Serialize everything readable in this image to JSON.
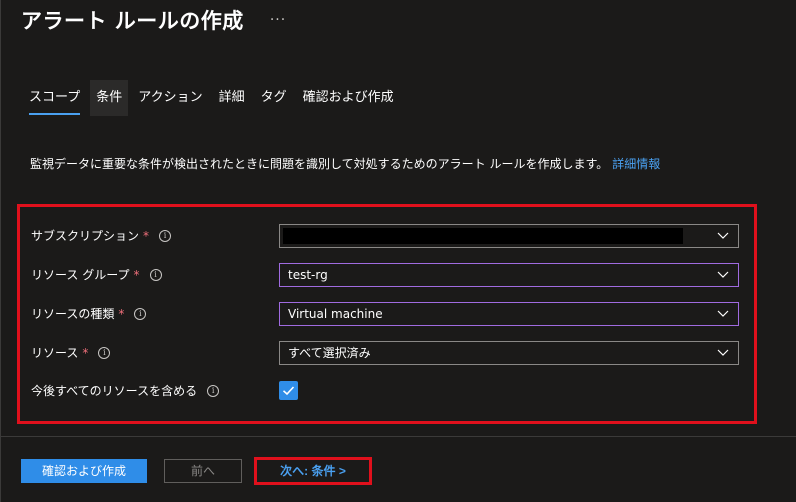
{
  "page": {
    "title": "アラート ルールの作成",
    "more_label": "···"
  },
  "tabs": [
    {
      "label": "スコープ",
      "active": true
    },
    {
      "label": "条件",
      "active": false
    },
    {
      "label": "アクション",
      "active": false
    },
    {
      "label": "詳細",
      "active": false
    },
    {
      "label": "タグ",
      "active": false
    },
    {
      "label": "確認および作成",
      "active": false
    }
  ],
  "description": {
    "text": "監視データに重要な条件が検出されたときに問題を識別して対処するためのアラート ルールを作成します。",
    "link": "詳細情報"
  },
  "form": {
    "required_mark": "*",
    "info_glyph": "i",
    "subscription": {
      "label": "サブスクリプション",
      "value": ""
    },
    "resource_group": {
      "label": "リソース グループ",
      "value": "test-rg"
    },
    "resource_type": {
      "label": "リソースの種類",
      "value": "Virtual machine"
    },
    "resource": {
      "label": "リソース",
      "value": "すべて選択済み"
    },
    "include_future": {
      "label": "今後すべてのリソースを含める",
      "checked": true
    }
  },
  "footer": {
    "review_create": "確認および作成",
    "previous": "前へ",
    "next": "次へ: 条件 >"
  },
  "colors": {
    "accent": "#2f8de8",
    "link": "#4aa0f0",
    "highlight": "#e0101c",
    "required": "#f1707b",
    "focus_border": "#a06be0"
  }
}
